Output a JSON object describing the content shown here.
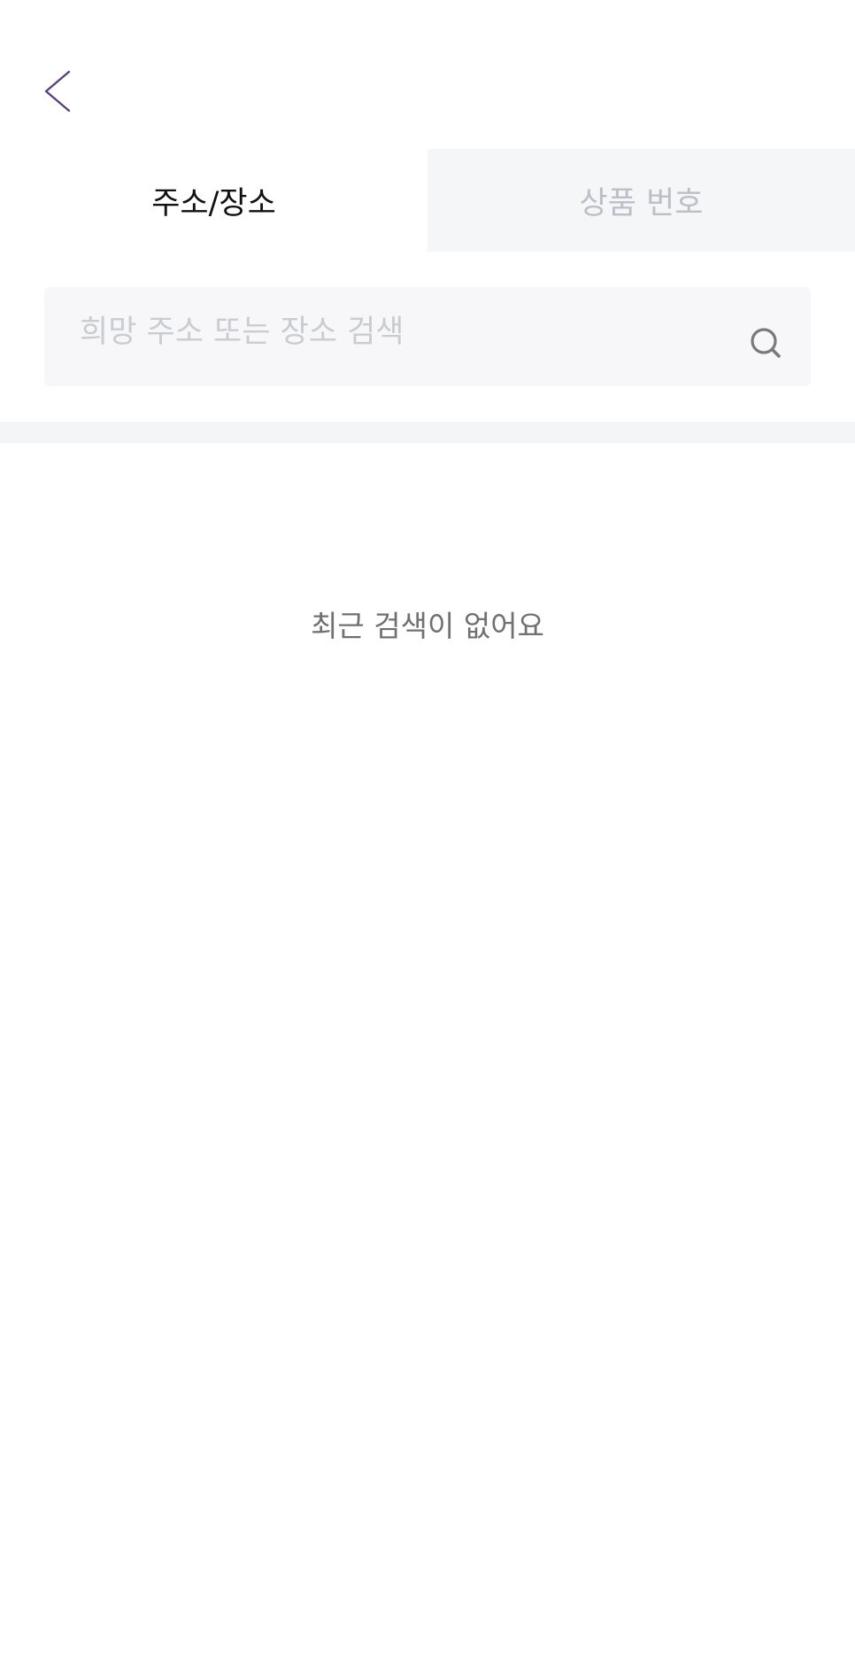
{
  "header": {
    "back_icon": "chevron-left-icon",
    "accent_color": "#5b3f86"
  },
  "tabs": [
    {
      "label": "주소/장소",
      "active": true
    },
    {
      "label": "상품 번호",
      "active": false
    }
  ],
  "search": {
    "placeholder": "희망 주소 또는 장소 검색",
    "value": "",
    "icon": "search-icon"
  },
  "recent": {
    "empty_message": "최근 검색이 없어요"
  }
}
